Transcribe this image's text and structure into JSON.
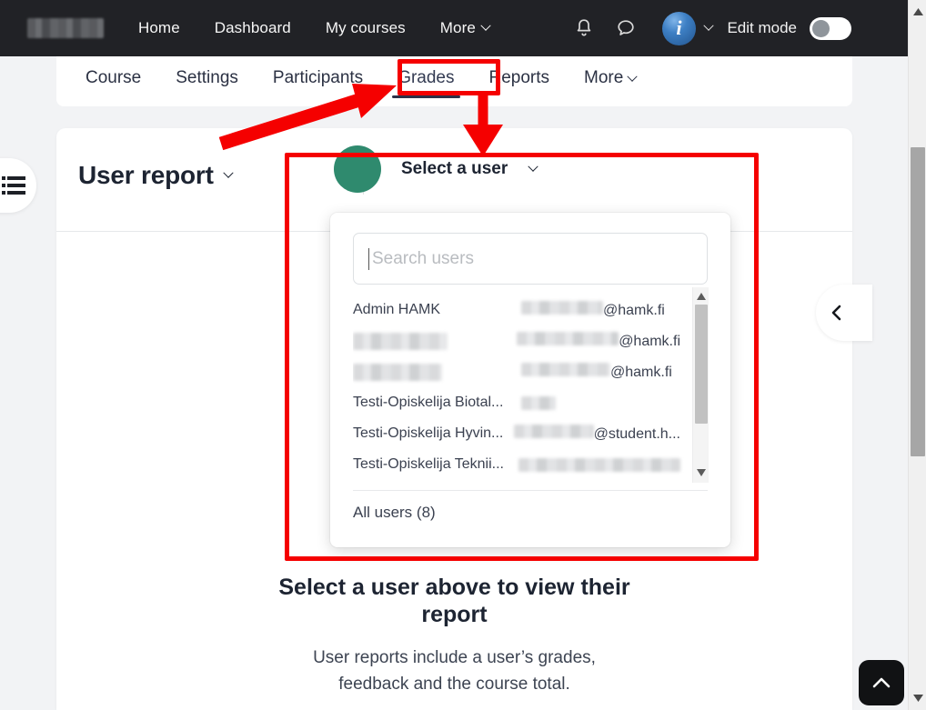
{
  "navbar": {
    "logo_alt": "site-logo-redacted",
    "links": [
      {
        "label": "Home"
      },
      {
        "label": "Dashboard"
      },
      {
        "label": "My courses"
      },
      {
        "label": "More"
      }
    ],
    "icons": [
      {
        "name": "bell-icon"
      },
      {
        "name": "message-icon"
      }
    ],
    "avatar_initial": "i",
    "edit_mode_label": "Edit mode",
    "edit_mode_on": false,
    "background_color": "#212226"
  },
  "tabs": [
    {
      "label": "Course",
      "active": false
    },
    {
      "label": "Settings",
      "active": false
    },
    {
      "label": "Participants",
      "active": false
    },
    {
      "label": "Grades",
      "active": true
    },
    {
      "label": "Reports",
      "active": false
    },
    {
      "label": "More",
      "active": false,
      "has_caret": true
    }
  ],
  "report": {
    "title": "User report",
    "select_user_label": "Select a user",
    "avatar_color": "#2f8a6e"
  },
  "dropdown": {
    "search_placeholder": "Search users",
    "search_value": "",
    "users": [
      {
        "name": "Admin HAMK",
        "name_redacted": false,
        "email": "@hamk.fi",
        "email_redacted": true,
        "email_redact_width": 90
      },
      {
        "name": "",
        "name_redacted": true,
        "name_redact_width": 104,
        "email": "@hamk.fi",
        "email_redacted": true,
        "email_redact_width": 112
      },
      {
        "name": "",
        "name_redacted": true,
        "name_redact_width": 98,
        "email": "@hamk.fi",
        "email_redacted": true,
        "email_redact_width": 98
      },
      {
        "name": "Testi-Opiskelija Biotal...",
        "name_redacted": false,
        "email": "",
        "email_redacted": true,
        "email_redact_width": 38
      },
      {
        "name": "Testi-Opiskelija Hyvin...",
        "name_redacted": false,
        "email": "@student.h...",
        "email_redacted": true,
        "email_redact_width": 88
      },
      {
        "name": "Testi-Opiskelija Teknii...",
        "name_redacted": false,
        "email": "",
        "email_redacted": true,
        "email_redact_width": 178
      }
    ],
    "all_users_label": "All users (8)"
  },
  "empty_state": {
    "title": "Select a user above to view their report",
    "subtitle": "User reports include a user’s grades, feedback and the course total."
  },
  "drawers": {
    "index_icon": "list-icon",
    "right_toggle_icon": "chevron-left-icon"
  },
  "scroll_top": {
    "icon": "chevron-up-icon"
  },
  "annotation": {
    "color": "#f50000"
  }
}
